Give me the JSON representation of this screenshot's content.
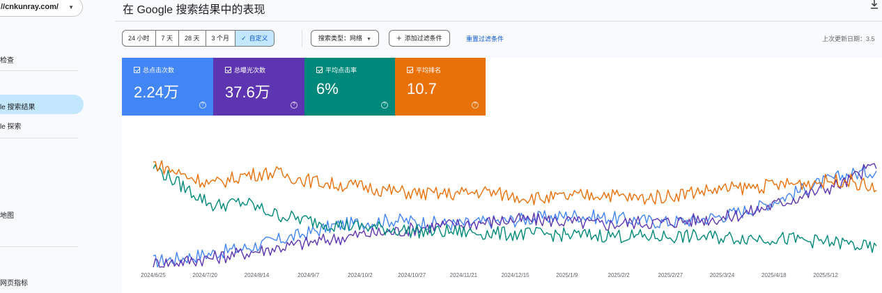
{
  "sidebar": {
    "property": "//cnkunray.com/",
    "items": [
      {
        "label": "检查"
      },
      {
        "label": "le 搜索结果"
      },
      {
        "label": "le 探索"
      },
      {
        "label": "地图"
      },
      {
        "label": "网页指标"
      }
    ]
  },
  "header": {
    "title": "在 Google 搜索结果中的表现"
  },
  "filters": {
    "ranges": [
      "24 小时",
      "7 天",
      "28 天",
      "3 个月",
      "自定义"
    ],
    "search_type": "搜索类型：网络",
    "add_filter": "添加过滤条件",
    "reset": "重置过滤条件",
    "last_update": "上次更新日期：3.5"
  },
  "metrics": [
    {
      "label": "总点击次数",
      "value": "2.24万",
      "color": "#4285f4"
    },
    {
      "label": "总曝光次数",
      "value": "37.6万",
      "color": "#5e35b1"
    },
    {
      "label": "平均点击率",
      "value": "6%",
      "color": "#00897b"
    },
    {
      "label": "平均排名",
      "value": "10.7",
      "color": "#e8710a"
    }
  ],
  "chart_data": {
    "type": "line",
    "x_tick_labels": [
      "2024/6/25",
      "2024/7/20",
      "2024/8/14",
      "2024/9/7",
      "2024/10/2",
      "2024/10/27",
      "2024/11/21",
      "2024/12/15",
      "2025/1/9",
      "2025/2/2",
      "2025/2/27",
      "2025/3/24",
      "2025/4/18",
      "2025/5/12"
    ],
    "normalized": true,
    "ylim": [
      0,
      100
    ],
    "series": [
      {
        "color": "#4285f4",
        "values": [
          5,
          8,
          12,
          16,
          22,
          28,
          35,
          38,
          40,
          38,
          36,
          38,
          40,
          42,
          44,
          42,
          40,
          38,
          40,
          44,
          50,
          60,
          70,
          78,
          82
        ]
      },
      {
        "color": "#5e35b1",
        "values": [
          3,
          5,
          8,
          12,
          16,
          20,
          24,
          28,
          30,
          34,
          36,
          38,
          40,
          40,
          38,
          36,
          38,
          38,
          40,
          42,
          48,
          56,
          64,
          72,
          88
        ]
      },
      {
        "color": "#00897b",
        "values": [
          85,
          68,
          52,
          55,
          45,
          40,
          36,
          34,
          32,
          30,
          30,
          29,
          28,
          28,
          27,
          27,
          26,
          26,
          26,
          25,
          25,
          24,
          22,
          20,
          15
        ]
      },
      {
        "color": "#e8710a",
        "values": [
          88,
          78,
          70,
          78,
          80,
          74,
          70,
          68,
          64,
          62,
          62,
          64,
          60,
          58,
          60,
          62,
          58,
          60,
          64,
          66,
          68,
          70,
          72,
          74,
          66
        ]
      }
    ]
  }
}
